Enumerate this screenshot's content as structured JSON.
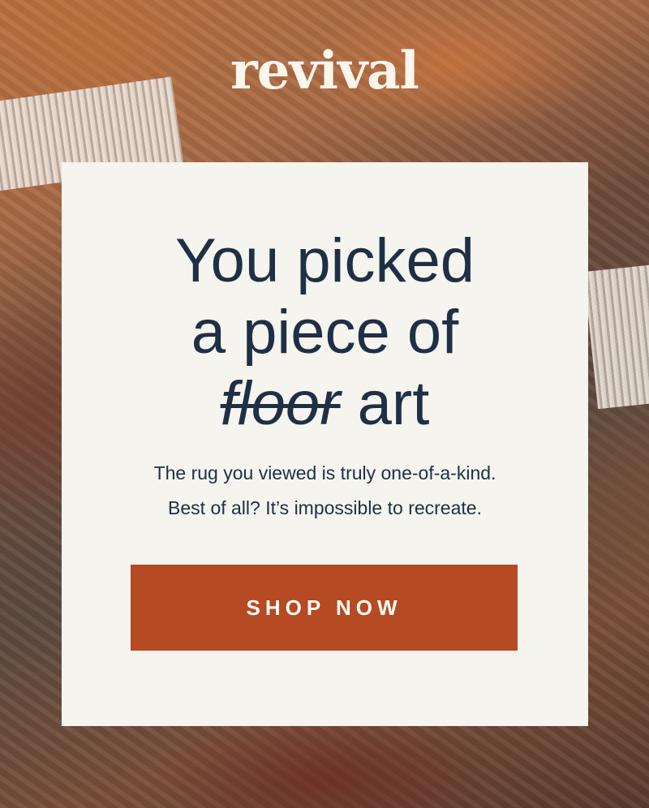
{
  "brand": {
    "logo_text": "revival"
  },
  "hero": {
    "headline_line1": "You picked",
    "headline_line2": "a piece of",
    "headline_struck_word": "floor",
    "headline_tail": "art",
    "body_line1": "The rug you viewed is truly one-of-a-kind.",
    "body_line2": "Best of all? It’s impossible to recreate.",
    "cta_label": "SHOP NOW"
  },
  "colors": {
    "card_background": "#f5f4ee",
    "headline_text": "#1f2f45",
    "cta_background": "#b64a22",
    "logo_text": "#fbf6ec"
  }
}
